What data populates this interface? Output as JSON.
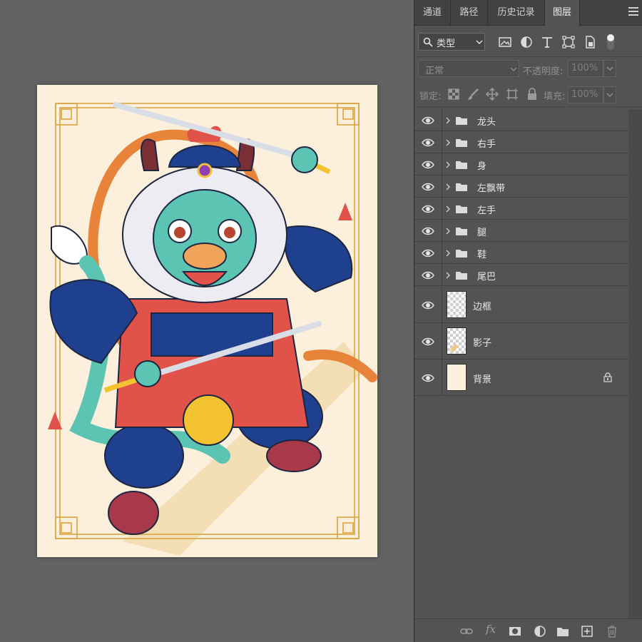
{
  "tabs": [
    {
      "label": "通道"
    },
    {
      "label": "路径"
    },
    {
      "label": "历史记录"
    },
    {
      "label": "图层"
    }
  ],
  "filter": {
    "type_label": "类型",
    "icons": [
      "image-filter-icon",
      "adjustment-filter-icon",
      "text-filter-icon",
      "shape-filter-icon",
      "smart-object-filter-icon",
      "filter-toggle-icon"
    ]
  },
  "blend": {
    "mode": "正常",
    "opacity_label": "不透明度:",
    "opacity_value": "100%"
  },
  "lock": {
    "label": "锁定:",
    "icons": [
      "lock-transparent-icon",
      "lock-image-icon",
      "lock-position-icon",
      "lock-artboard-icon",
      "lock-all-icon"
    ],
    "fill_label": "填充:",
    "fill_value": "100%"
  },
  "layers": [
    {
      "name": "龙头",
      "kind": "group"
    },
    {
      "name": "右手",
      "kind": "group"
    },
    {
      "name": "身",
      "kind": "group"
    },
    {
      "name": "左飘带",
      "kind": "group"
    },
    {
      "name": "左手",
      "kind": "group"
    },
    {
      "name": "腿",
      "kind": "group"
    },
    {
      "name": "鞋",
      "kind": "group"
    },
    {
      "name": "尾巴",
      "kind": "group"
    },
    {
      "name": "边框",
      "kind": "layer",
      "thumb": "transparent"
    },
    {
      "name": "影子",
      "kind": "layer",
      "thumb": "shadow"
    },
    {
      "name": "背景",
      "kind": "layer",
      "thumb": "background",
      "locked": true
    }
  ],
  "bottom_icons": [
    "link-layers-icon",
    "fx-icon",
    "layer-mask-icon",
    "adjustment-layer-icon",
    "new-group-icon",
    "new-layer-icon",
    "delete-layer-icon"
  ],
  "bottom_fx_label": "fx",
  "colors": {
    "canvas_bg": "#fcf0dc",
    "frame_gold": "#d9a441",
    "navy": "#1f3f8f",
    "red": "#e0524a",
    "teal": "#5cc4b3",
    "orange": "#e8833a"
  }
}
